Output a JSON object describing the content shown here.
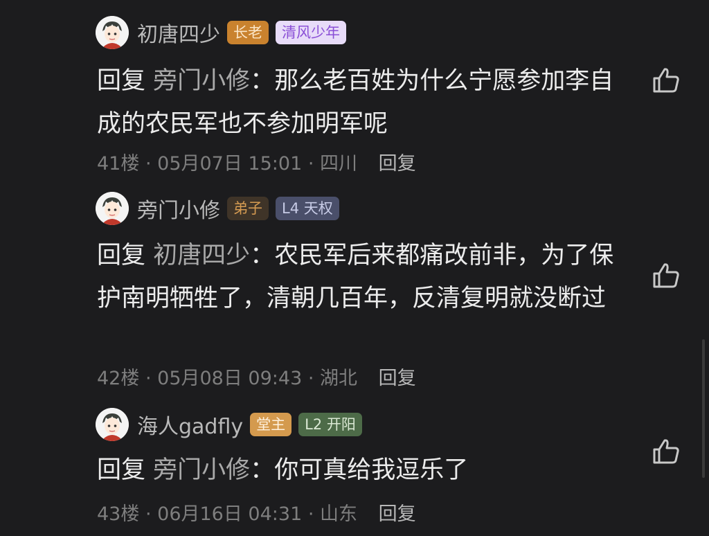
{
  "comments": [
    {
      "username": "初唐四少",
      "badges": [
        {
          "text": "长老",
          "bg": "#c9822e",
          "fg": "#fbe6c8"
        },
        {
          "text": "清风少年",
          "bg": "#e8dcf9",
          "fg": "#8a4fd6"
        }
      ],
      "reply_prefix": "回复",
      "reply_target": "旁门小修",
      "separator": "：",
      "text": "那么老百姓为什么宁愿参加李自成的农民军也不参加明军呢",
      "floor": "41楼",
      "dot": "·",
      "date": "05月07日 15:01",
      "location": "四川",
      "reply_label": "回复"
    },
    {
      "username": "旁门小修",
      "badges": [
        {
          "text": "弟子",
          "bg": "#3f3428",
          "fg": "#d59b52"
        },
        {
          "text": "L4 天权",
          "bg": "#4a4f6a",
          "fg": "#c7cbe6"
        }
      ],
      "reply_prefix": "回复",
      "reply_target": "初唐四少",
      "separator": "：",
      "text": "农民军后来都痛改前非，为了保护南明牺牲了，清朝几百年，反清复明就没断过",
      "floor": "42楼",
      "dot": "·",
      "date": "05月08日 09:43",
      "location": "湖北",
      "reply_label": "回复"
    },
    {
      "username": "海人gadfly",
      "badges": [
        {
          "text": "堂主",
          "bg": "#d49a4e",
          "fg": "#fff2df"
        },
        {
          "text": "L2 开阳",
          "bg": "#4d6b48",
          "fg": "#dbe9d5"
        }
      ],
      "reply_prefix": "回复",
      "reply_target": "旁门小修",
      "separator": "：",
      "text": "你可真给我逗乐了",
      "floor": "43楼",
      "dot": "·",
      "date": "06月16日 04:31",
      "location": "山东",
      "reply_label": "回复"
    }
  ]
}
